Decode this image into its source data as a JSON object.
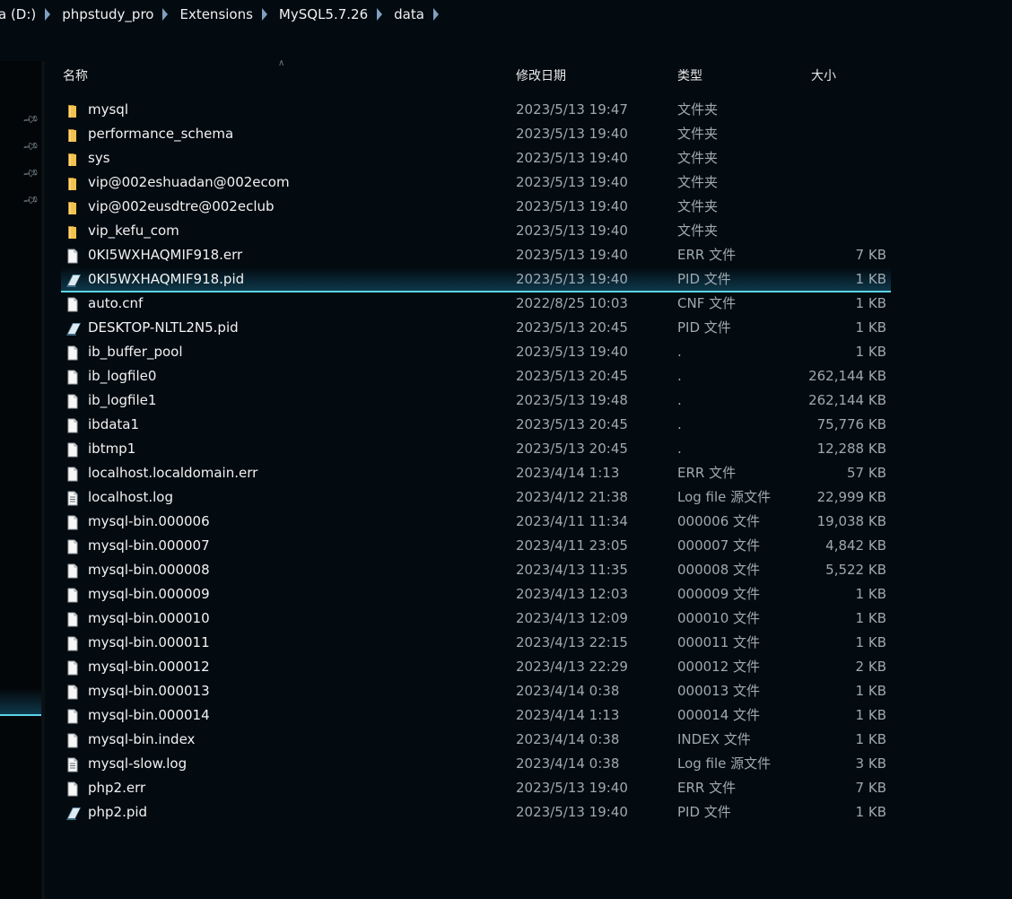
{
  "breadcrumb": [
    "a (D:)",
    "phpstudy_pro",
    "Extensions",
    "MySQL5.7.26",
    "data"
  ],
  "columns": {
    "name": "名称",
    "date": "修改日期",
    "type": "类型",
    "size": "大小"
  },
  "files": [
    {
      "name": "mysql",
      "date": "2023/5/13 19:47",
      "type": "文件夹",
      "size": "",
      "icon": "folder-icon"
    },
    {
      "name": "performance_schema",
      "date": "2023/5/13 19:40",
      "type": "文件夹",
      "size": "",
      "icon": "folder-icon"
    },
    {
      "name": "sys",
      "date": "2023/5/13 19:40",
      "type": "文件夹",
      "size": "",
      "icon": "folder-icon"
    },
    {
      "name": "vip@002eshuadan@002ecom",
      "date": "2023/5/13 19:40",
      "type": "文件夹",
      "size": "",
      "icon": "folder-icon"
    },
    {
      "name": "vip@002eusdtre@002eclub",
      "date": "2023/5/13 19:40",
      "type": "文件夹",
      "size": "",
      "icon": "folder-icon"
    },
    {
      "name": "vip_kefu_com",
      "date": "2023/5/13 19:40",
      "type": "文件夹",
      "size": "",
      "icon": "folder-icon"
    },
    {
      "name": "0KI5WXHAQMIF918.err",
      "date": "2023/5/13 19:40",
      "type": "ERR 文件",
      "size": "7 KB",
      "icon": "file-icon"
    },
    {
      "name": "0KI5WXHAQMIF918.pid",
      "date": "2023/5/13 19:40",
      "type": "PID 文件",
      "size": "1 KB",
      "icon": "pid-file-icon",
      "selected": true
    },
    {
      "name": "auto.cnf",
      "date": "2022/8/25 10:03",
      "type": "CNF 文件",
      "size": "1 KB",
      "icon": "file-icon"
    },
    {
      "name": "DESKTOP-NLTL2N5.pid",
      "date": "2023/5/13 20:45",
      "type": "PID 文件",
      "size": "1 KB",
      "icon": "pid-file-icon"
    },
    {
      "name": "ib_buffer_pool",
      "date": "2023/5/13 19:40",
      "type": ".",
      "size": "1 KB",
      "icon": "file-icon"
    },
    {
      "name": "ib_logfile0",
      "date": "2023/5/13 20:45",
      "type": ".",
      "size": "262,144 KB",
      "icon": "file-icon"
    },
    {
      "name": "ib_logfile1",
      "date": "2023/5/13 19:48",
      "type": ".",
      "size": "262,144 KB",
      "icon": "file-icon"
    },
    {
      "name": "ibdata1",
      "date": "2023/5/13 20:45",
      "type": ".",
      "size": "75,776 KB",
      "icon": "file-icon"
    },
    {
      "name": "ibtmp1",
      "date": "2023/5/13 20:45",
      "type": ".",
      "size": "12,288 KB",
      "icon": "file-icon"
    },
    {
      "name": "localhost.localdomain.err",
      "date": "2023/4/14 1:13",
      "type": "ERR 文件",
      "size": "57 KB",
      "icon": "file-icon"
    },
    {
      "name": "localhost.log",
      "date": "2023/4/12 21:38",
      "type": "Log file 源文件",
      "size": "22,999 KB",
      "icon": "text-file-icon"
    },
    {
      "name": "mysql-bin.000006",
      "date": "2023/4/11 11:34",
      "type": "000006 文件",
      "size": "19,038 KB",
      "icon": "file-icon"
    },
    {
      "name": "mysql-bin.000007",
      "date": "2023/4/11 23:05",
      "type": "000007 文件",
      "size": "4,842 KB",
      "icon": "file-icon"
    },
    {
      "name": "mysql-bin.000008",
      "date": "2023/4/13 11:35",
      "type": "000008 文件",
      "size": "5,522 KB",
      "icon": "file-icon"
    },
    {
      "name": "mysql-bin.000009",
      "date": "2023/4/13 12:03",
      "type": "000009 文件",
      "size": "1 KB",
      "icon": "file-icon"
    },
    {
      "name": "mysql-bin.000010",
      "date": "2023/4/13 12:09",
      "type": "000010 文件",
      "size": "1 KB",
      "icon": "file-icon"
    },
    {
      "name": "mysql-bin.000011",
      "date": "2023/4/13 22:15",
      "type": "000011 文件",
      "size": "1 KB",
      "icon": "file-icon"
    },
    {
      "name": "mysql-bin.000012",
      "date": "2023/4/13 22:29",
      "type": "000012 文件",
      "size": "2 KB",
      "icon": "file-icon"
    },
    {
      "name": "mysql-bin.000013",
      "date": "2023/4/14 0:38",
      "type": "000013 文件",
      "size": "1 KB",
      "icon": "file-icon"
    },
    {
      "name": "mysql-bin.000014",
      "date": "2023/4/14 1:13",
      "type": "000014 文件",
      "size": "1 KB",
      "icon": "file-icon"
    },
    {
      "name": "mysql-bin.index",
      "date": "2023/4/14 0:38",
      "type": "INDEX 文件",
      "size": "1 KB",
      "icon": "file-icon"
    },
    {
      "name": "mysql-slow.log",
      "date": "2023/4/14 0:38",
      "type": "Log file 源文件",
      "size": "3 KB",
      "icon": "text-file-icon"
    },
    {
      "name": "php2.err",
      "date": "2023/5/13 19:40",
      "type": "ERR 文件",
      "size": "7 KB",
      "icon": "file-icon"
    },
    {
      "name": "php2.pid",
      "date": "2023/5/13 19:40",
      "type": "PID 文件",
      "size": "1 KB",
      "icon": "pid-file-icon"
    }
  ],
  "colors": {
    "background": "#030a10",
    "selection_accent": "#5fd3ea",
    "folder": "#f2c14e",
    "secondary_text": "#9fa9b1"
  }
}
